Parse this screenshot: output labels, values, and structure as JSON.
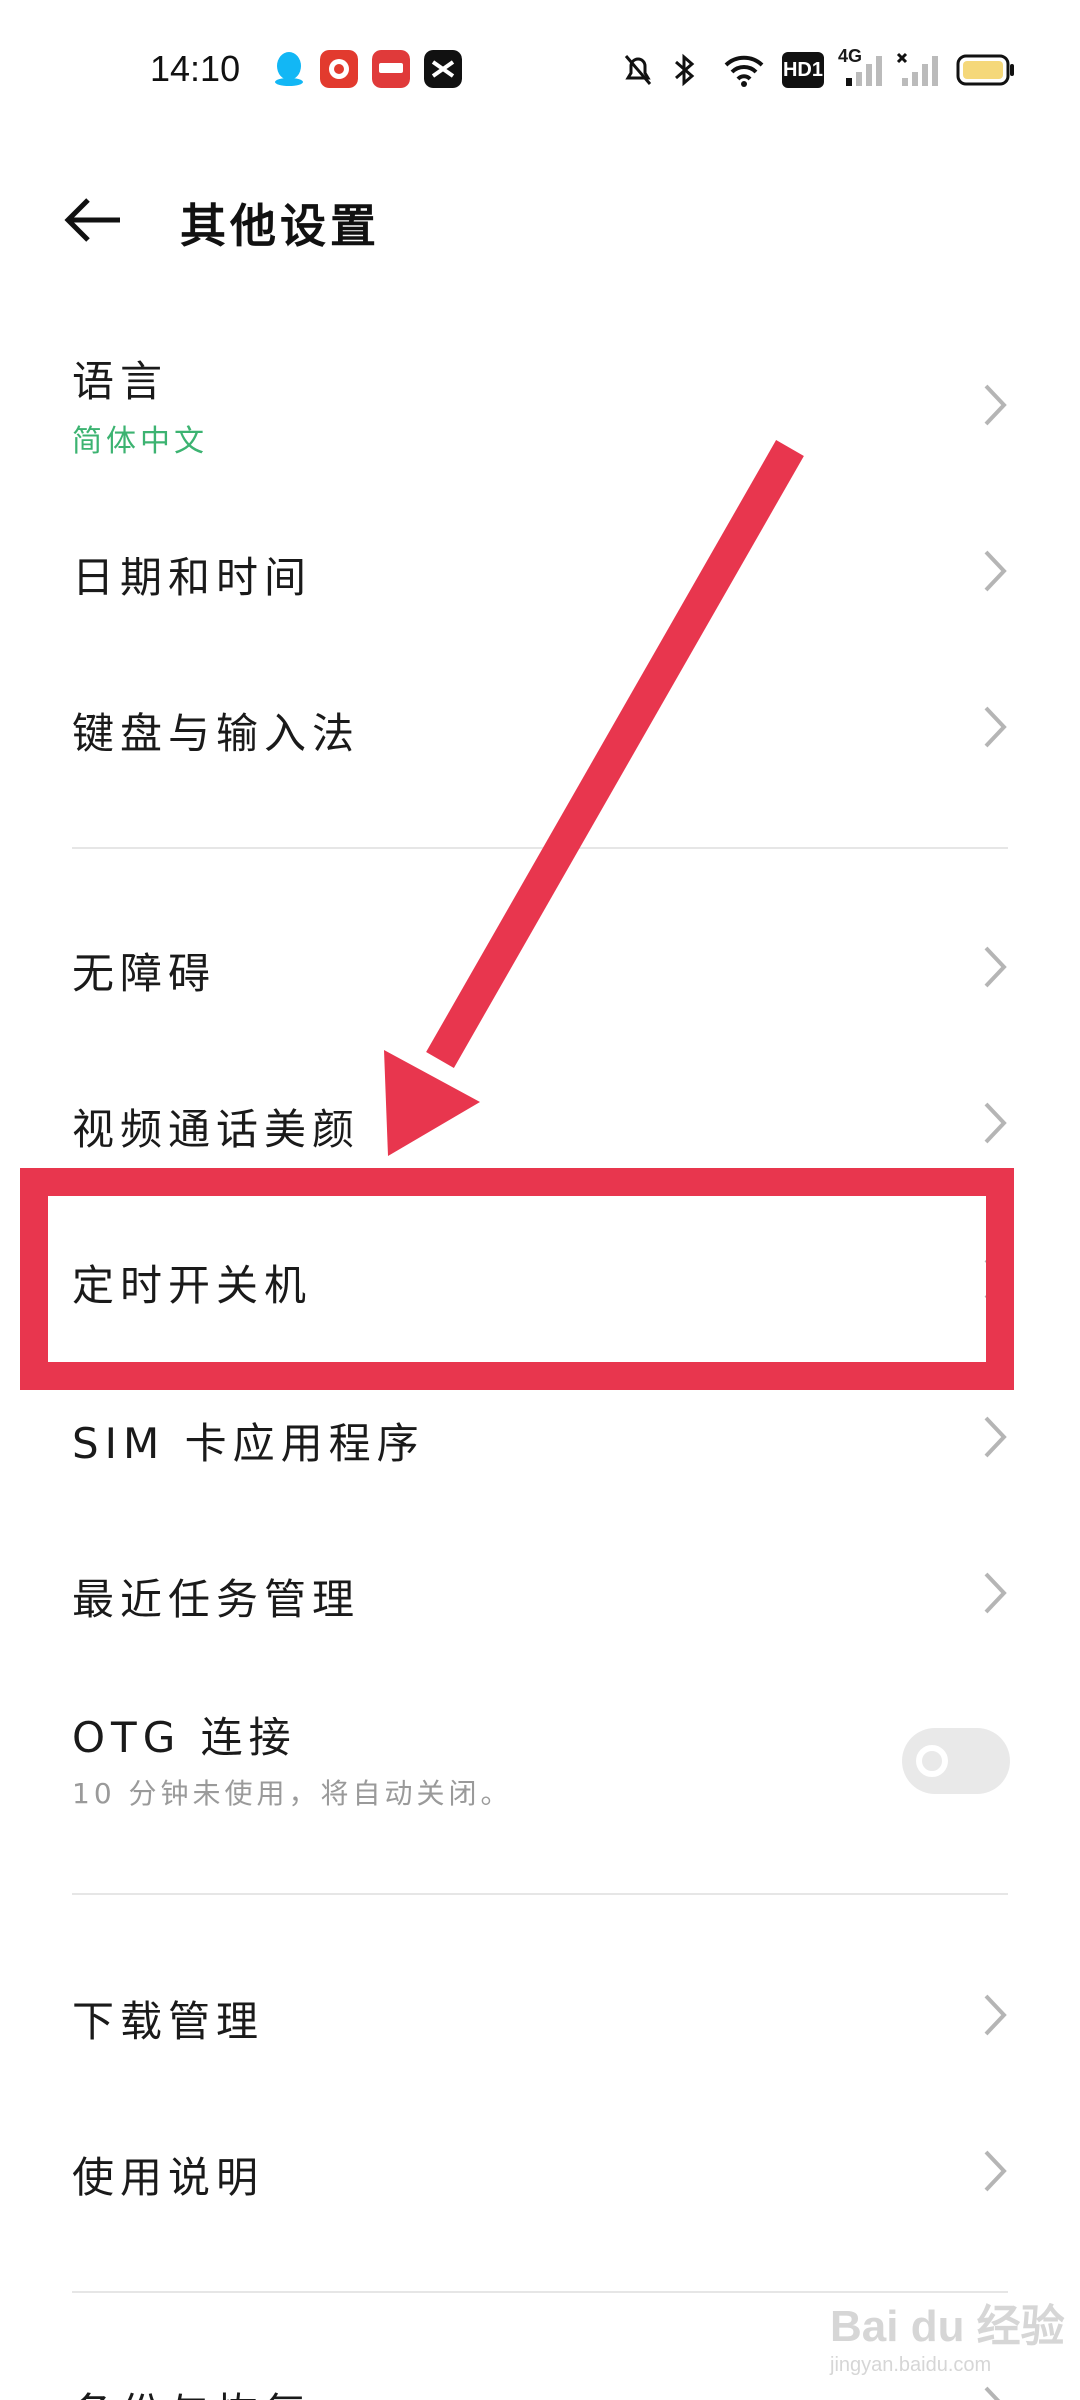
{
  "status_bar": {
    "time": "14:10",
    "network_label": "4G",
    "hd_label": "HD1",
    "battery_color": "#f5d87a"
  },
  "header": {
    "title": "其他设置"
  },
  "settings": {
    "language": {
      "label": "语言",
      "value": "简体中文"
    },
    "date_time": {
      "label": "日期和时间"
    },
    "keyboard": {
      "label": "键盘与输入法"
    },
    "accessibility": {
      "label": "无障碍"
    },
    "video_beauty": {
      "label": "视频通话美颜"
    },
    "scheduled_power": {
      "label": "定时开关机"
    },
    "sim_apps": {
      "label": "SIM 卡应用程序"
    },
    "recent_tasks": {
      "label": "最近任务管理"
    },
    "otg": {
      "label": "OTG 连接",
      "description": "10 分钟未使用，将自动关闭。",
      "enabled": false
    },
    "download_manager": {
      "label": "下载管理"
    },
    "user_manual": {
      "label": "使用说明"
    },
    "backup": {
      "label": "备份与恢复"
    }
  },
  "colors": {
    "accent_green": "#3cb371",
    "annotation_red": "#e8364e"
  },
  "watermark": {
    "brand": "Bai du 经验",
    "url": "jingyan.baidu.com"
  }
}
